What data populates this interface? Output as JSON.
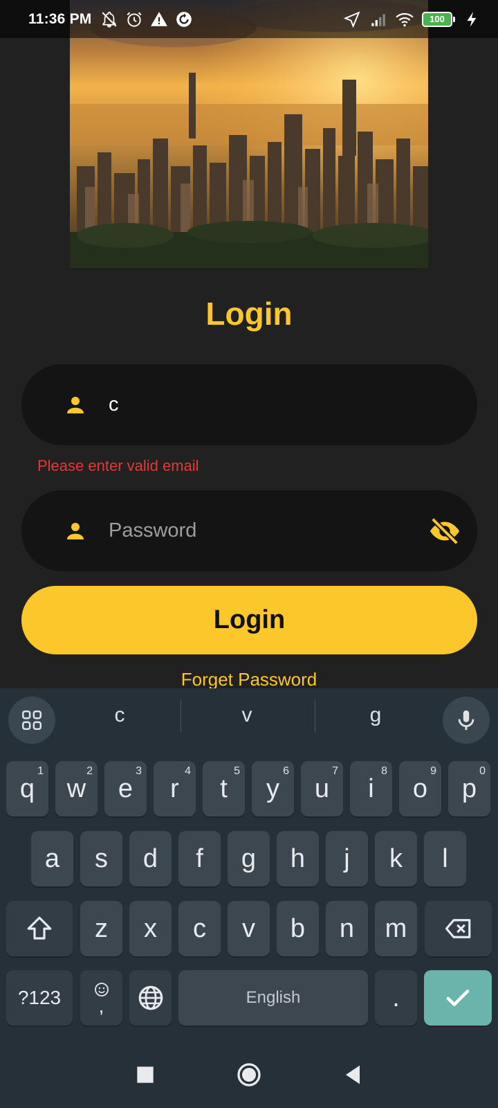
{
  "status_bar": {
    "time": "11:36 PM",
    "battery": "100"
  },
  "page": {
    "title": "Login"
  },
  "email_field": {
    "value": "c",
    "error": "Please enter valid email"
  },
  "password_field": {
    "placeholder": "Password"
  },
  "login_button": {
    "label": "Login"
  },
  "forget_link": {
    "label": "Forget Password"
  },
  "keyboard": {
    "suggestions": [
      "c",
      "v",
      "g"
    ],
    "row1": [
      {
        "k": "q",
        "h": "1"
      },
      {
        "k": "w",
        "h": "2"
      },
      {
        "k": "e",
        "h": "3"
      },
      {
        "k": "r",
        "h": "4"
      },
      {
        "k": "t",
        "h": "5"
      },
      {
        "k": "y",
        "h": "6"
      },
      {
        "k": "u",
        "h": "7"
      },
      {
        "k": "i",
        "h": "8"
      },
      {
        "k": "o",
        "h": "9"
      },
      {
        "k": "p",
        "h": "0"
      }
    ],
    "row2": [
      "a",
      "s",
      "d",
      "f",
      "g",
      "h",
      "j",
      "k",
      "l"
    ],
    "row3": [
      "z",
      "x",
      "c",
      "v",
      "b",
      "n",
      "m"
    ],
    "symbols_label": "?123",
    "comma_label": ",",
    "space_label": "English",
    "period_label": "."
  },
  "colors": {
    "accent": "#fcc72a",
    "error": "#e53935",
    "background": "#212121",
    "field": "#141414",
    "keyboard": "#263038"
  }
}
